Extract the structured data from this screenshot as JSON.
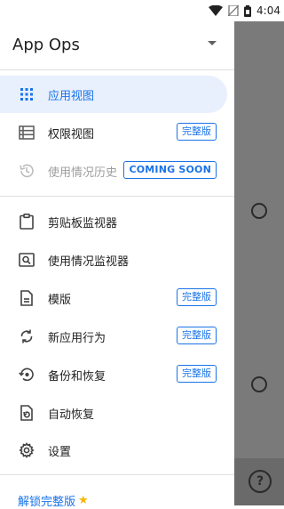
{
  "status_bar": {
    "time": "4:04"
  },
  "drawer": {
    "app_title": "App Ops",
    "section1": [
      {
        "label": "应用视图",
        "icon": "grid-icon",
        "active": true
      },
      {
        "label": "权限视图",
        "icon": "list-icon",
        "badge": "完整版"
      },
      {
        "label": "使用情况历史",
        "icon": "history-icon",
        "disabled": true,
        "badge": "COMING SOON"
      }
    ],
    "section2": [
      {
        "label": "剪贴板监视器",
        "icon": "clipboard-icon"
      },
      {
        "label": "使用情况监视器",
        "icon": "monitor-icon"
      },
      {
        "label": "模版",
        "icon": "document-icon",
        "badge": "完整版"
      },
      {
        "label": "新应用行为",
        "icon": "sync-icon",
        "badge": "完整版"
      },
      {
        "label": "备份和恢复",
        "icon": "restore-icon",
        "badge": "完整版"
      },
      {
        "label": "自动恢复",
        "icon": "file-restore-icon"
      },
      {
        "label": "设置",
        "icon": "gear-icon"
      }
    ],
    "unlock_label": "解锁完整版",
    "help_glyph": "?"
  },
  "colors": {
    "accent": "#1a73e8",
    "active_bg": "#e8f0fe",
    "star": "#f6b500"
  }
}
